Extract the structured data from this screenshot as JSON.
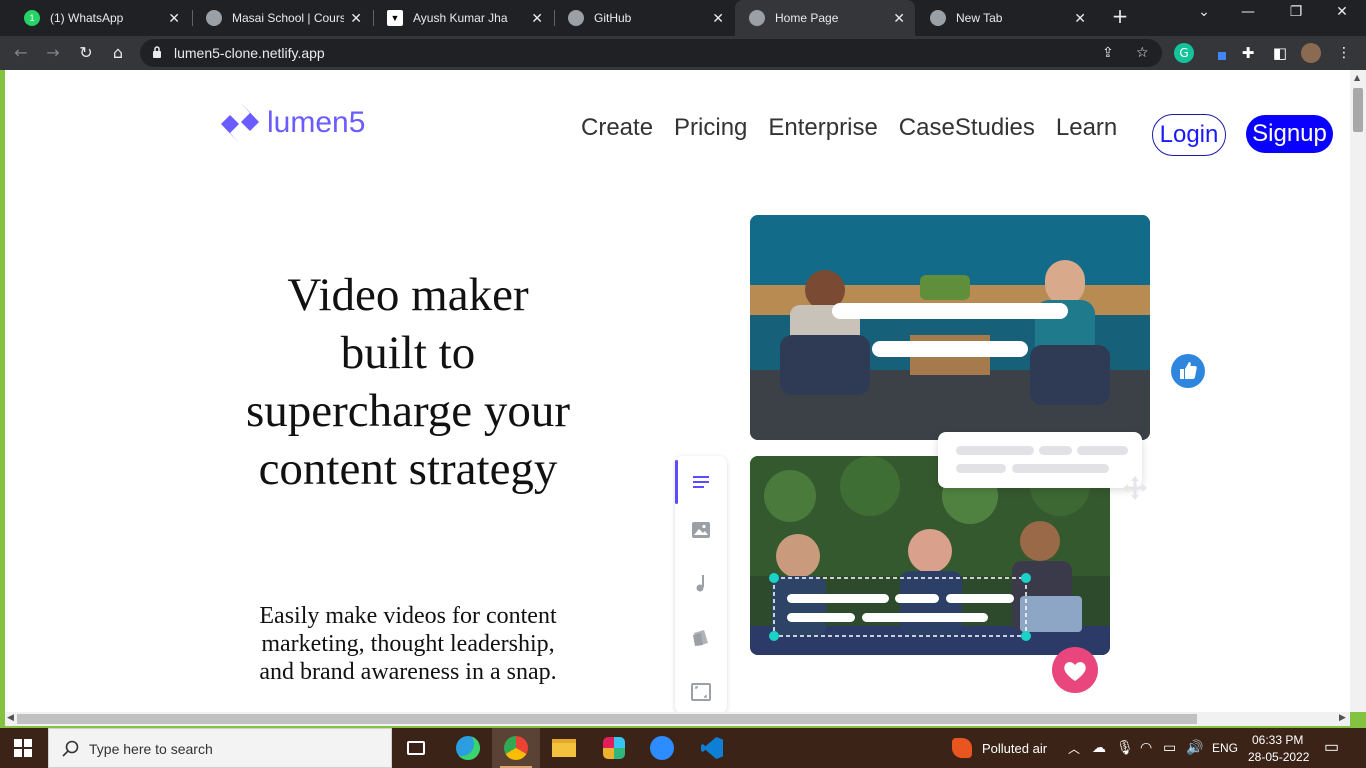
{
  "browser": {
    "tabs": [
      {
        "title": "(1) WhatsApp",
        "icon": "whatsapp-icon",
        "favicon_color": "#25d366"
      },
      {
        "title": "Masai School | Course",
        "icon": "globe-icon",
        "favicon_color": "#9aa0a6"
      },
      {
        "title": "Ayush Kumar Jha",
        "icon": "vercel-icon",
        "favicon_color": "#ffffff"
      },
      {
        "title": "GitHub",
        "icon": "github-icon",
        "favicon_color": "#9aa0a6"
      },
      {
        "title": "Home Page",
        "icon": "globe-icon",
        "favicon_color": "#9aa0a6",
        "active": true
      },
      {
        "title": "New Tab",
        "icon": "chrome-icon",
        "favicon_color": "#9aa0a6"
      }
    ],
    "url": "lumen5-clone.netlify.app"
  },
  "page": {
    "logo_text": "lumen5",
    "brand_color": "#6a5cff",
    "nav": [
      "Create",
      "Pricing",
      "Enterprise",
      "CaseStudies",
      "Learn"
    ],
    "login_label": "Login",
    "signup_label": "Signup",
    "hero_title": "Video maker built to supercharge your content strategy",
    "hero_subtitle": "Easily make videos for content marketing, thought leadership, and brand awareness in a snap."
  },
  "taskbar": {
    "search_placeholder": "Type here to search",
    "weather": "Polluted air",
    "language": "ENG",
    "time": "06:33 PM",
    "date": "28-05-2022"
  }
}
